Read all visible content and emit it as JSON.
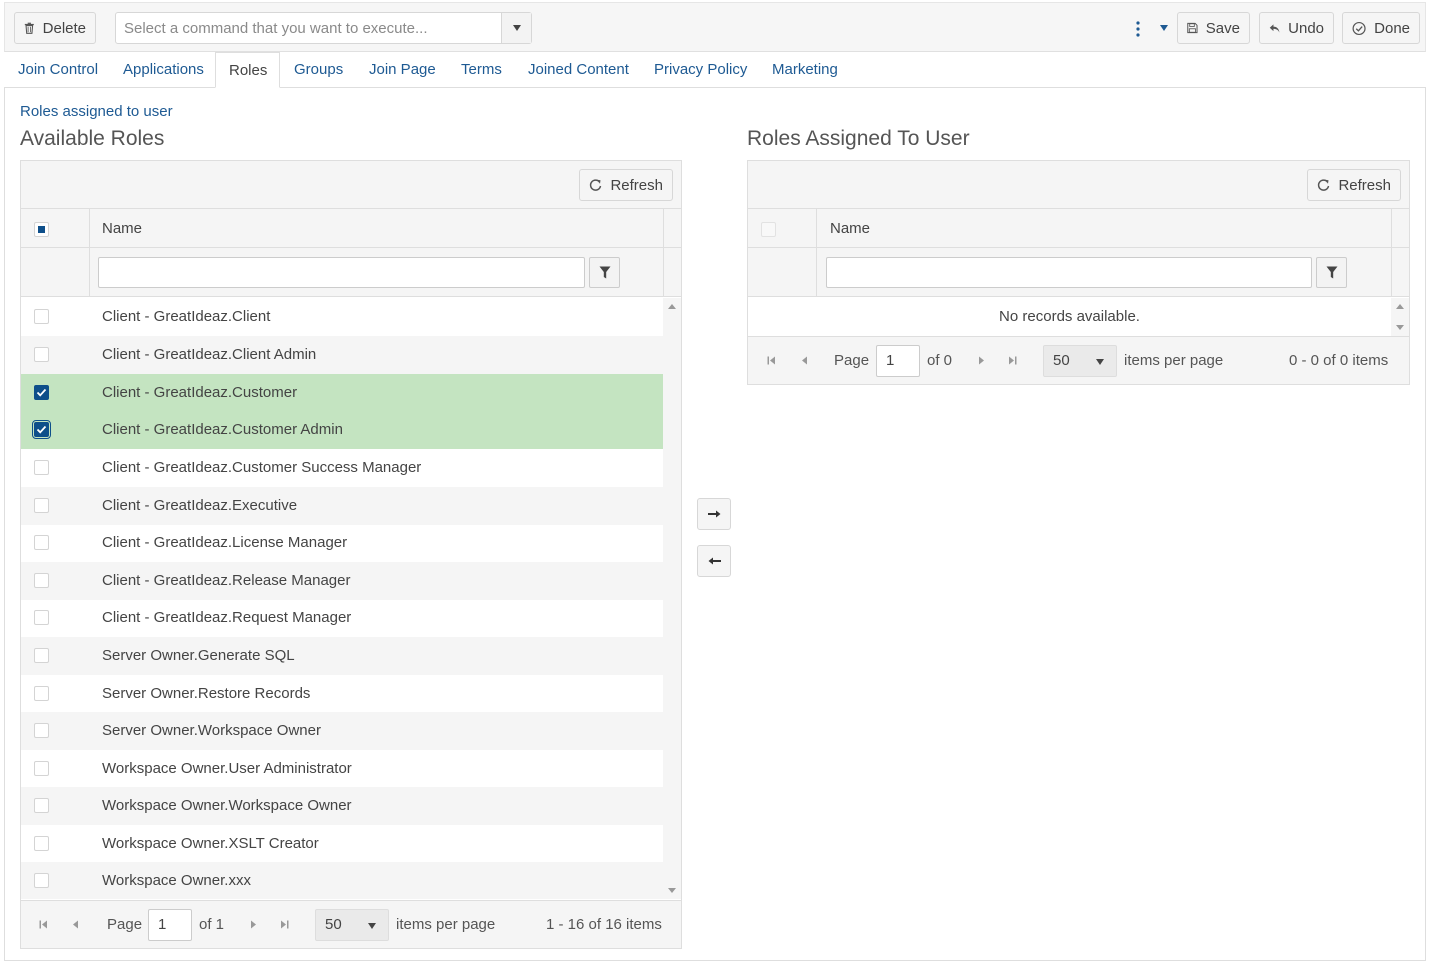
{
  "toolbar": {
    "delete_label": "Delete",
    "command_placeholder": "Select a command that you want to execute...",
    "save_label": "Save",
    "undo_label": "Undo",
    "done_label": "Done"
  },
  "tabs": [
    {
      "label": "Join Control",
      "active": false
    },
    {
      "label": "Applications",
      "active": false
    },
    {
      "label": "Roles",
      "active": true
    },
    {
      "label": "Groups",
      "active": false
    },
    {
      "label": "Join Page",
      "active": false
    },
    {
      "label": "Terms",
      "active": false
    },
    {
      "label": "Joined Content",
      "active": false
    },
    {
      "label": "Privacy Policy",
      "active": false
    },
    {
      "label": "Marketing",
      "active": false
    }
  ],
  "roles_link": "Roles assigned to user",
  "available": {
    "heading": "Available Roles",
    "refresh_label": "Refresh",
    "column_header": "Name",
    "rows": [
      {
        "name": "Client - GreatIdeaz.Client",
        "checked": false
      },
      {
        "name": "Client - GreatIdeaz.Client Admin",
        "checked": false
      },
      {
        "name": "Client - GreatIdeaz.Customer",
        "checked": true
      },
      {
        "name": "Client - GreatIdeaz.Customer Admin",
        "checked": true
      },
      {
        "name": "Client - GreatIdeaz.Customer Success Manager",
        "checked": false
      },
      {
        "name": "Client - GreatIdeaz.Executive",
        "checked": false
      },
      {
        "name": "Client - GreatIdeaz.License Manager",
        "checked": false
      },
      {
        "name": "Client - GreatIdeaz.Release Manager",
        "checked": false
      },
      {
        "name": "Client - GreatIdeaz.Request Manager",
        "checked": false
      },
      {
        "name": "Server Owner.Generate SQL",
        "checked": false
      },
      {
        "name": "Server Owner.Restore Records",
        "checked": false
      },
      {
        "name": "Server Owner.Workspace Owner",
        "checked": false
      },
      {
        "name": "Workspace Owner.User Administrator",
        "checked": false
      },
      {
        "name": "Workspace Owner.Workspace Owner",
        "checked": false
      },
      {
        "name": "Workspace Owner.XSLT Creator",
        "checked": false
      },
      {
        "name": "Workspace Owner.xxx",
        "checked": false
      }
    ],
    "pager": {
      "page_label": "Page",
      "page": "1",
      "of_label": "of 1",
      "per_page": "50",
      "per_page_label": "items per page",
      "summary": "1 - 16 of 16 items"
    }
  },
  "assigned": {
    "heading": "Roles Assigned To User",
    "refresh_label": "Refresh",
    "column_header": "Name",
    "empty_message": "No records available.",
    "pager": {
      "page_label": "Page",
      "page": "1",
      "of_label": "of 0",
      "per_page": "50",
      "per_page_label": "items per page",
      "summary": "0 - 0 of 0 items"
    }
  }
}
